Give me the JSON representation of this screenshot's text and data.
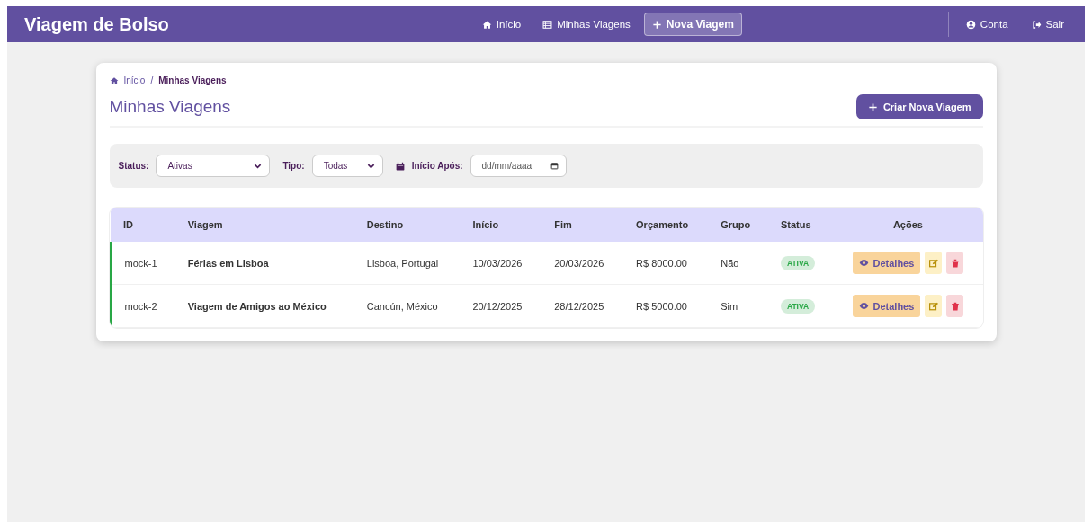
{
  "navbar": {
    "brand": "Viagem de Bolso",
    "links": [
      {
        "label": "Início",
        "kind": "home",
        "selected": false
      },
      {
        "label": "Minhas Viagens",
        "kind": "list",
        "selected": false
      },
      {
        "label": "Nova Viagem",
        "kind": "new",
        "selected": true
      }
    ],
    "account_links": [
      {
        "label": "Conta",
        "kind": "account"
      },
      {
        "label": "Sair",
        "kind": "logout"
      }
    ]
  },
  "breadcrumb": {
    "home": "Início",
    "separator": "/",
    "current": "Minhas Viagens"
  },
  "title": "Minhas Viagens",
  "create_button": "Criar Nova Viagem",
  "filters": {
    "status": {
      "label": "Status:",
      "value": "Ativas"
    },
    "type": {
      "label": "Tipo:",
      "value": "Todas"
    },
    "start_after": {
      "label": "Início Após:",
      "placeholder": "dd/mm/aaaa"
    }
  },
  "table": {
    "columns": [
      "ID",
      "Viagem",
      "Destino",
      "Início",
      "Fim",
      "Orçamento",
      "Grupo",
      "Status",
      "Ações"
    ],
    "rows": [
      {
        "id": "mock-1",
        "trip": "Férias em Lisboa",
        "destination": "Lisboa, Portugal",
        "start": "10/03/2026",
        "end": "20/03/2026",
        "budget": "R$ 8000.00",
        "group": "Não",
        "status": {
          "label": "ATIVA",
          "kind": "active"
        },
        "details_button": "Detalhes"
      },
      {
        "id": "mock-2",
        "trip": "Viagem de Amigos ao México",
        "destination": "Cancún, México",
        "start": "20/12/2025",
        "end": "28/12/2025",
        "budget": "R$ 5000.00",
        "group": "Sim",
        "status": {
          "label": "ATIVA",
          "kind": "active"
        },
        "details_button": "Detalhes"
      }
    ]
  }
}
